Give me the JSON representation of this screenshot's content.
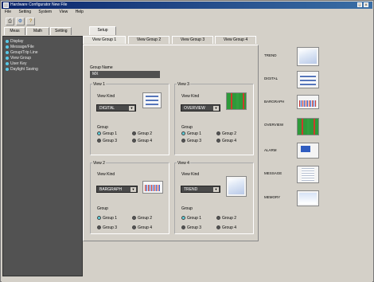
{
  "window": {
    "title": "Hardware Configurator  New File",
    "min_icon": "minimize-icon",
    "close_icon": "close-icon"
  },
  "menu": [
    "File",
    "Setting",
    "System",
    "View",
    "Help"
  ],
  "toolbar": {
    "icons": [
      "print-icon",
      "config-icon",
      "help-icon"
    ]
  },
  "main_tabs": [
    "Meas",
    "Math",
    "Setting",
    "Setup"
  ],
  "sidebar": {
    "items": [
      "Display",
      "Message/File",
      "Group/Trip Line",
      "View Group",
      "User Key",
      "Daylight Saving"
    ]
  },
  "sub_tabs": [
    "View Group 1",
    "View Group 2",
    "View Group 3",
    "View Group 4"
  ],
  "group_name": {
    "label": "Group Name",
    "value": "MX"
  },
  "views": [
    {
      "title": "View 1",
      "kind_label": "View Kind",
      "kind": "DIGITAL",
      "group_label": "Group",
      "radios": [
        {
          "label": "Group 1",
          "on": true
        },
        {
          "label": "Group 2",
          "on": false
        },
        {
          "label": "Group 3",
          "on": false
        },
        {
          "label": "Group 4",
          "on": false
        }
      ],
      "thumb": "digital"
    },
    {
      "title": "View 3",
      "kind_label": "View Kind",
      "kind": "OVERVIEW",
      "group_label": "Group",
      "radios": [
        {
          "label": "Group 1",
          "on": true
        },
        {
          "label": "Group 2",
          "on": false
        },
        {
          "label": "Group 3",
          "on": false
        },
        {
          "label": "Group 4",
          "on": false
        }
      ],
      "thumb": "overview"
    },
    {
      "title": "View 2",
      "kind_label": "View Kind",
      "kind": "BARGRAPH",
      "group_label": "Group",
      "radios": [
        {
          "label": "Group 1",
          "on": true
        },
        {
          "label": "Group 2",
          "on": false
        },
        {
          "label": "Group 3",
          "on": false
        },
        {
          "label": "Group 4",
          "on": false
        }
      ],
      "thumb": "bargraph"
    },
    {
      "title": "View 4",
      "kind_label": "View Kind",
      "kind": "TREND",
      "group_label": "Group",
      "radios": [
        {
          "label": "Group 1",
          "on": true
        },
        {
          "label": "Group 2",
          "on": false
        },
        {
          "label": "Group 3",
          "on": false
        },
        {
          "label": "Group 4",
          "on": false
        }
      ],
      "thumb": "trend"
    }
  ],
  "view_types": [
    {
      "label": "TREND",
      "thumb": "trend"
    },
    {
      "label": "DIGITAL",
      "thumb": "digital"
    },
    {
      "label": "BARGRAPH",
      "thumb": "bargraph"
    },
    {
      "label": "OVERVIEW",
      "thumb": "overview"
    },
    {
      "label": "ALARM",
      "thumb": "alarm"
    },
    {
      "label": "MESSAGE",
      "thumb": "message"
    },
    {
      "label": "MEMORY",
      "thumb": "memory"
    }
  ],
  "colors": {
    "sidebar_bg": "#525252",
    "radio_on": "#5dd0dc",
    "titlebar": "#0a246a"
  }
}
